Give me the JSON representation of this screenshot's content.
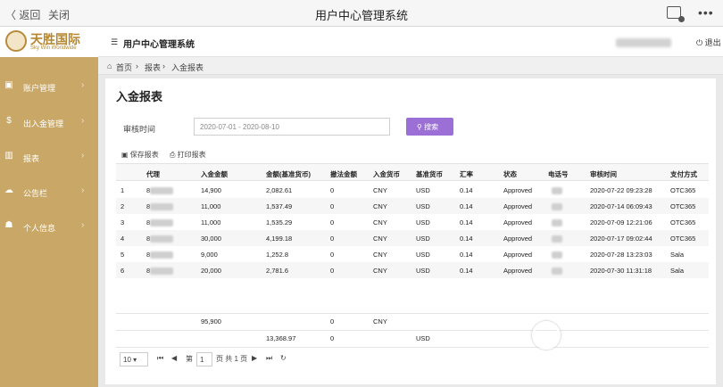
{
  "topbar": {
    "back": "〈 返回",
    "close": "关闭",
    "title": "用户中心管理系统"
  },
  "logo": {
    "cn": "天胜国际",
    "en": "Sky Win Worldwide"
  },
  "sidebar": {
    "items": [
      {
        "icon": "▣",
        "label": "账户管理"
      },
      {
        "icon": "$",
        "label": "出入金管理"
      },
      {
        "icon": "▥",
        "label": "报表"
      },
      {
        "icon": "☁",
        "label": "公告栏"
      },
      {
        "icon": "☗",
        "label": "个人信息"
      }
    ]
  },
  "header": {
    "system_title": "用户中心管理系统",
    "logout": "退出"
  },
  "breadcrumb": {
    "home": "首页",
    "reports": "报表",
    "current": "入金报表"
  },
  "page": {
    "title": "入金报表"
  },
  "filter": {
    "label": "审核时间",
    "date_range": "2020-07-01 - 2020-08-10",
    "search": "搜索"
  },
  "toolbar": {
    "save": "保存报表",
    "print": "打印报表"
  },
  "table": {
    "headers": [
      "代理",
      "入金金额",
      "金额(基准货币)",
      "撤法金额",
      "入金货币",
      "基准货币",
      "汇率",
      "状态",
      "电话号",
      "审核时间",
      "支付方式"
    ],
    "rows": [
      {
        "no": "1",
        "agent": "8",
        "amount": "14,900",
        "base_amount": "2,082.61",
        "cancel": "0",
        "currency": "CNY",
        "base_currency": "USD",
        "rate": "0.14",
        "status": "Approved",
        "time": "2020-07-22 09:23:28",
        "pay": "OTC365"
      },
      {
        "no": "2",
        "agent": "8",
        "amount": "11,000",
        "base_amount": "1,537.49",
        "cancel": "0",
        "currency": "CNY",
        "base_currency": "USD",
        "rate": "0.14",
        "status": "Approved",
        "time": "2020-07-14 06:09:43",
        "pay": "OTC365"
      },
      {
        "no": "3",
        "agent": "8",
        "amount": "11,000",
        "base_amount": "1,535.29",
        "cancel": "0",
        "currency": "CNY",
        "base_currency": "USD",
        "rate": "0.14",
        "status": "Approved",
        "time": "2020-07-09 12:21:06",
        "pay": "OTC365"
      },
      {
        "no": "4",
        "agent": "8",
        "amount": "30,000",
        "base_amount": "4,199.18",
        "cancel": "0",
        "currency": "CNY",
        "base_currency": "USD",
        "rate": "0.14",
        "status": "Approved",
        "time": "2020-07-17 09:02:44",
        "pay": "OTC365"
      },
      {
        "no": "5",
        "agent": "8",
        "amount": "9,000",
        "base_amount": "1,252.8",
        "cancel": "0",
        "currency": "CNY",
        "base_currency": "USD",
        "rate": "0.14",
        "status": "Approved",
        "time": "2020-07-28 13:23:03",
        "pay": "Sala"
      },
      {
        "no": "6",
        "agent": "8",
        "amount": "20,000",
        "base_amount": "2,781.6",
        "cancel": "0",
        "currency": "CNY",
        "base_currency": "USD",
        "rate": "0.14",
        "status": "Approved",
        "time": "2020-07-30 11:31:18",
        "pay": "Sala"
      }
    ],
    "totals": {
      "amount": "95,900",
      "cancel1": "0",
      "currency": "CNY",
      "base_amount": "13,368.97",
      "cancel2": "0",
      "base_currency": "USD"
    }
  },
  "pager": {
    "size": "10",
    "page_label": "第",
    "page": "1",
    "of_label": "页 共 1 页"
  }
}
